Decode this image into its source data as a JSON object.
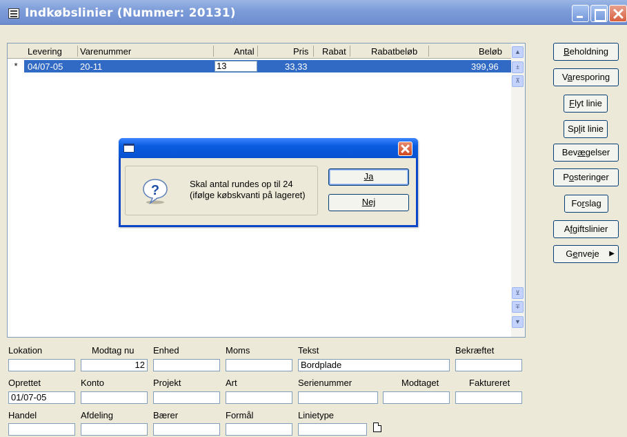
{
  "window": {
    "title": "Indkøbslinier (Nummer: 20131)"
  },
  "grid": {
    "columns": [
      "Levering",
      "Varenummer",
      "Antal",
      "Pris",
      "Rabat",
      "Rabatbeløb",
      "Beløb"
    ],
    "row": {
      "marker": "*",
      "levering": "04/07-05",
      "varenummer": "20-11",
      "antal": "13",
      "pris": "33,33",
      "rabat": "",
      "rabatbelob": "",
      "belob": "399,96"
    }
  },
  "side_buttons": [
    {
      "pre": "",
      "ul": "B",
      "post": "eholdning"
    },
    {
      "pre": "V",
      "ul": "a",
      "post": "resporing"
    },
    {
      "pre": "",
      "ul": "F",
      "post": "lyt linie"
    },
    {
      "pre": "Sp",
      "ul": "l",
      "post": "it linie"
    },
    {
      "pre": "Bev",
      "ul": "æ",
      "post": "gelser"
    },
    {
      "pre": "P",
      "ul": "o",
      "post": "steringer"
    },
    {
      "pre": "Fo",
      "ul": "r",
      "post": "slag"
    },
    {
      "pre": "A",
      "ul": "f",
      "post": "giftslinier"
    },
    {
      "pre": "G",
      "ul": "e",
      "post": "nveje"
    }
  ],
  "fields": {
    "lokation": {
      "label": "Lokation",
      "value": ""
    },
    "modtag_nu": {
      "label": "Modtag nu",
      "value": "12"
    },
    "enhed": {
      "label": "Enhed",
      "value": ""
    },
    "moms": {
      "label": "Moms",
      "value": ""
    },
    "tekst": {
      "label": "Tekst",
      "value": "Bordplade"
    },
    "bekraeftet": {
      "label": "Bekræftet",
      "value": ""
    },
    "oprettet": {
      "label": "Oprettet",
      "value": "01/07-05"
    },
    "konto": {
      "label": "Konto",
      "value": ""
    },
    "projekt": {
      "label": "Projekt",
      "value": ""
    },
    "art": {
      "label": "Art",
      "value": ""
    },
    "serienummer": {
      "label": "Serienummer",
      "value": ""
    },
    "modtaget": {
      "label": "Modtaget",
      "value": ""
    },
    "faktureret": {
      "label": "Faktureret",
      "value": ""
    },
    "handel": {
      "label": "Handel",
      "value": ""
    },
    "afdeling": {
      "label": "Afdeling",
      "value": ""
    },
    "baerer": {
      "label": "Bærer",
      "value": ""
    },
    "formal": {
      "label": "Formål",
      "value": ""
    },
    "linietype": {
      "label": "Linietype",
      "value": ""
    }
  },
  "dialog": {
    "message_line1": "Skal antal rundes op til 24",
    "message_line2": "(ifølge købskvanti på lageret)",
    "yes_label": "Ja",
    "no_label": "Nej"
  },
  "colors": {
    "selection": "#316ac5",
    "titlebar_inactive": "#7c9bd8",
    "dialog_titlebar": "#0a5ce0"
  }
}
